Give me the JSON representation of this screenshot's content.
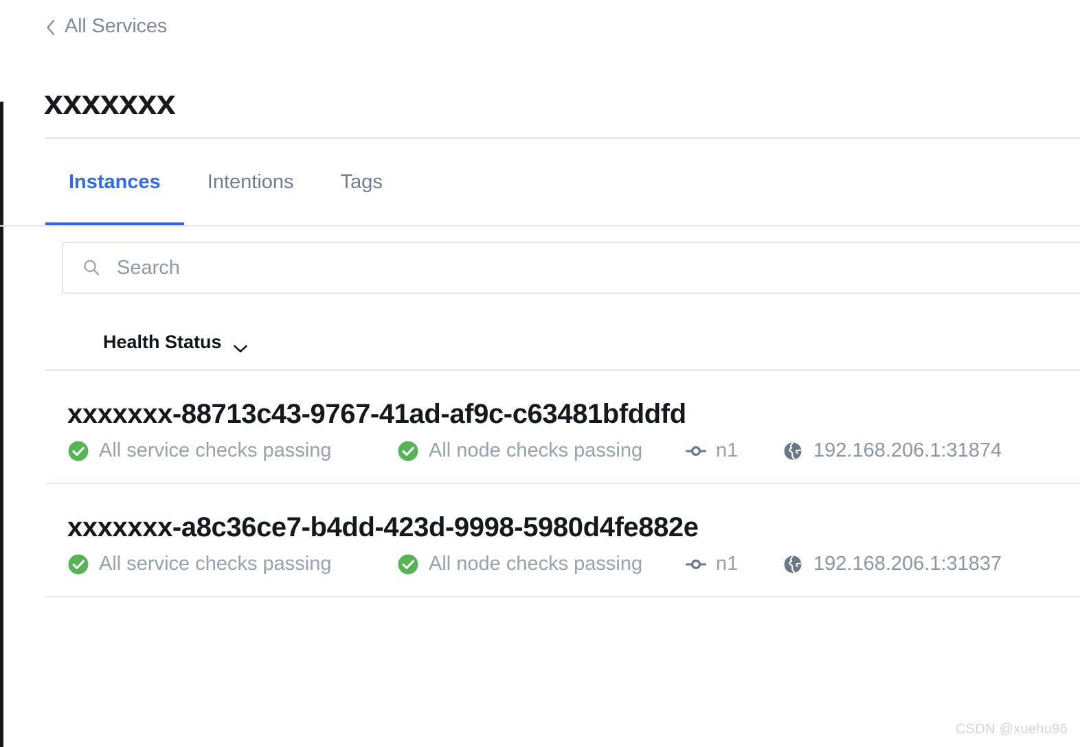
{
  "breadcrumb": {
    "back_label": "All Services",
    "icon": "chevron-left-icon"
  },
  "page_title": "xxxxxxx",
  "tabs": [
    {
      "label": "Instances",
      "active": true
    },
    {
      "label": "Intentions",
      "active": false
    },
    {
      "label": "Tags",
      "active": false
    }
  ],
  "search": {
    "placeholder": "Search",
    "value": "",
    "icon": "search-icon"
  },
  "filters": {
    "health_status_label": "Health Status",
    "caret_icon": "chevron-down-icon"
  },
  "instances": [
    {
      "name": "xxxxxxx-88713c43-9767-41ad-af9c-c63481bfddfd",
      "service_checks": "All service checks passing",
      "node_checks": "All node checks passing",
      "node": "n1",
      "address": "192.168.206.1:31874"
    },
    {
      "name": "xxxxxxx-a8c36ce7-b4dd-423d-9998-5980d4fe882e",
      "service_checks": "All service checks passing",
      "node_checks": "All node checks passing",
      "node": "n1",
      "address": "192.168.206.1:31837"
    }
  ],
  "watermark": "CSDN @xuehu96",
  "colors": {
    "accent": "#2f62f4",
    "healthy": "#56b356",
    "muted_text": "#98a2ae",
    "breadcrumb_text": "#7c8b9e",
    "rule": "#e2e6ea"
  }
}
